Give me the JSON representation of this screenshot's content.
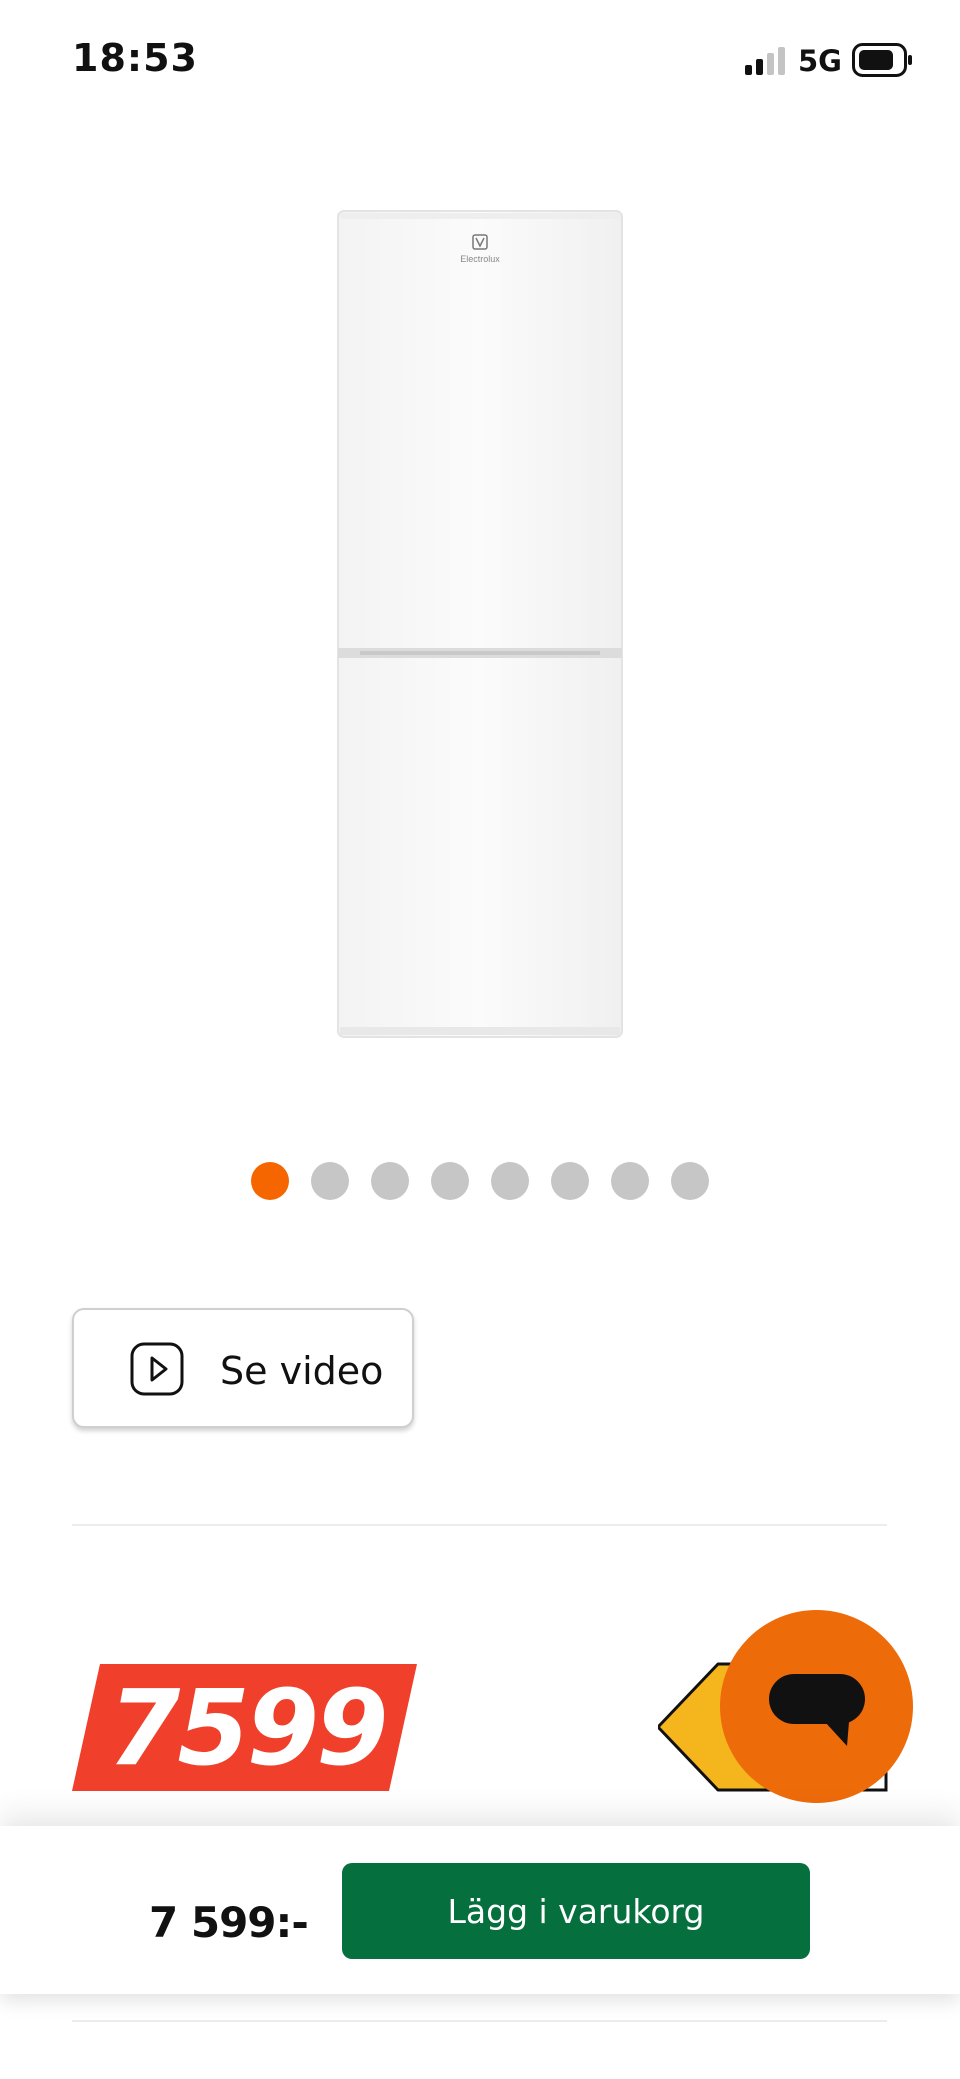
{
  "status_bar": {
    "time": "18:53",
    "network": "5G",
    "icons": [
      "signal-icon",
      "battery-icon"
    ]
  },
  "gallery": {
    "image_icon": "refrigerator-image",
    "brand_text": "Electrolux",
    "slide_count": 8,
    "active_slide": 1,
    "active_color": "#f56600",
    "inactive_color": "#c6c6c6"
  },
  "video": {
    "label": "Se video",
    "icon": "play-icon"
  },
  "price_tag": {
    "value": "7599",
    "color": "#f03f2a"
  },
  "energy_label": {
    "color": "#f5b51d"
  },
  "chat": {
    "icon": "chat-icon",
    "color": "#ee6b0a"
  },
  "bottom_bar": {
    "price": "7 599:-",
    "add_to_cart_label": "Lägg i varukorg",
    "button_color": "#05703d"
  }
}
